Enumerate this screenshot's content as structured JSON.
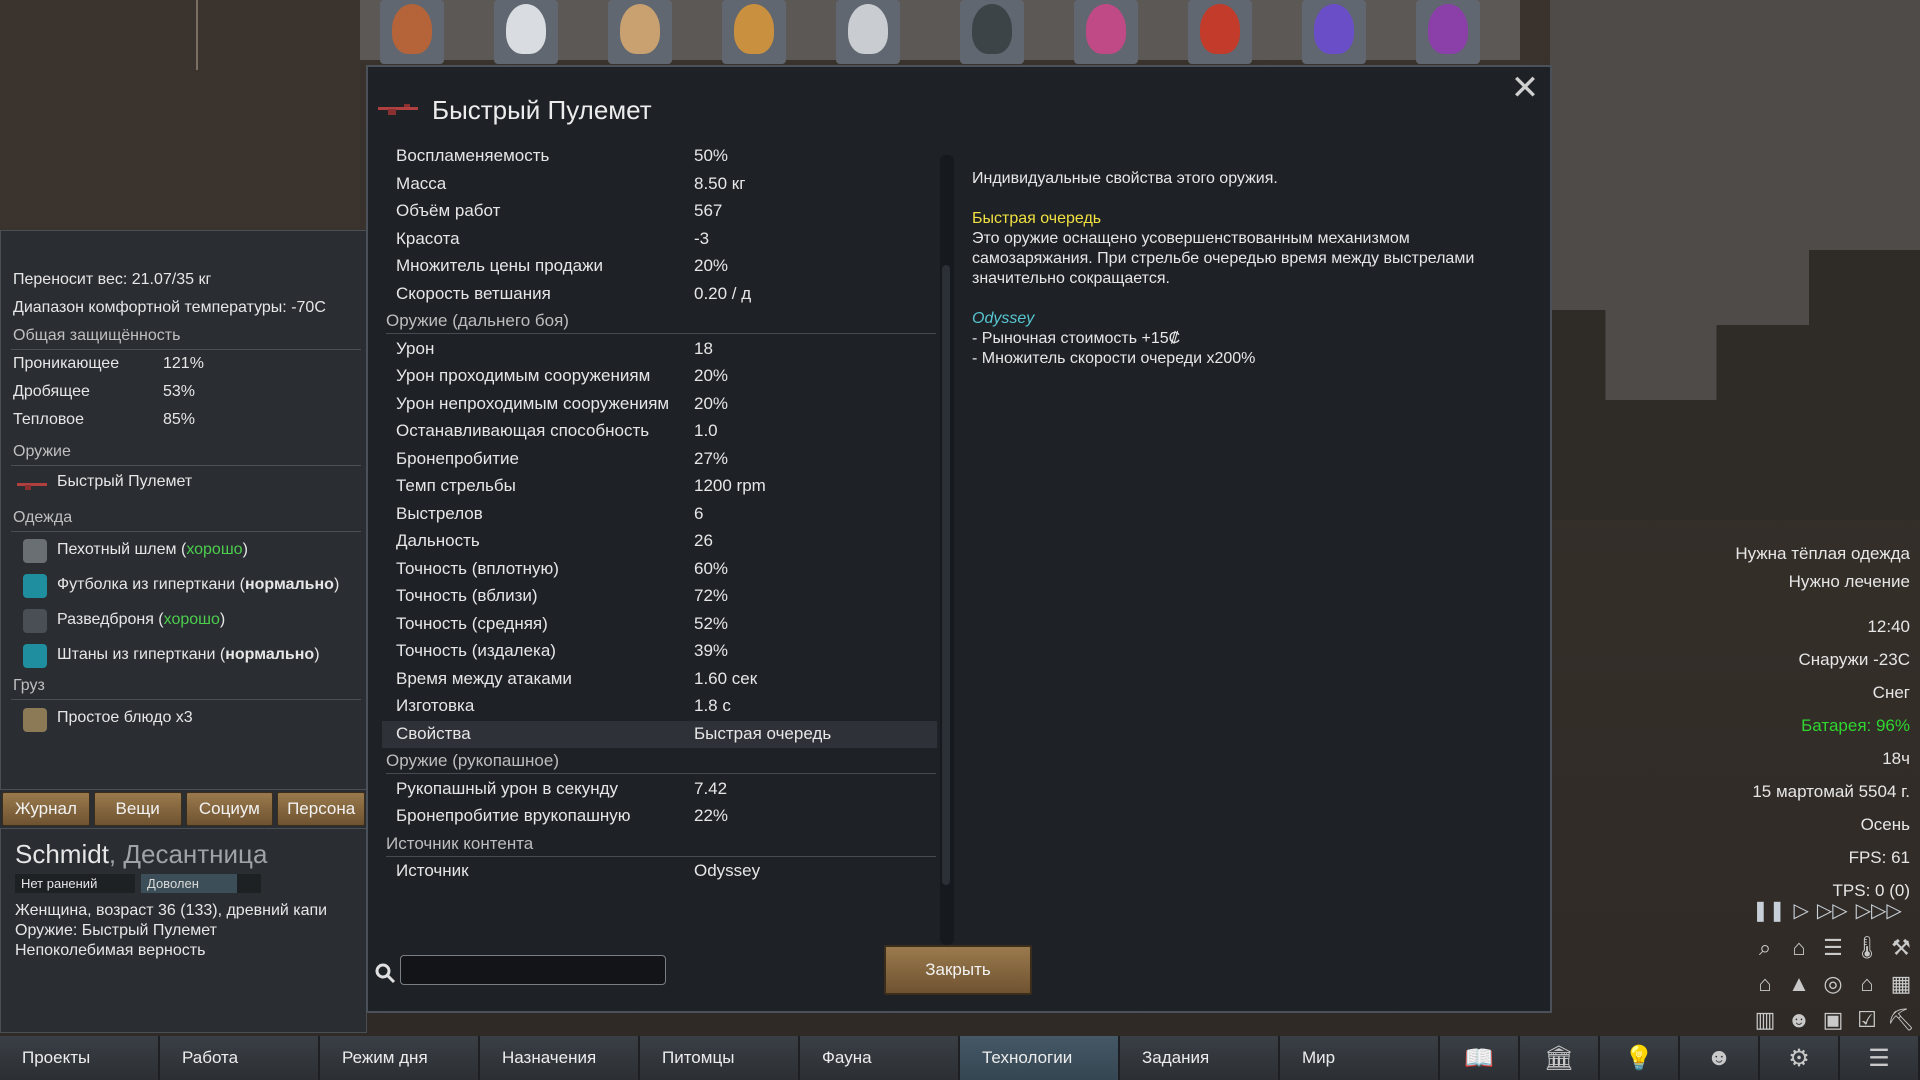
{
  "colonists": [
    {
      "name": "colonist-1",
      "color": "#b5643a"
    },
    {
      "name": "colonist-2",
      "color": "#d9dde2"
    },
    {
      "name": "colonist-3",
      "color": "#c9a070"
    },
    {
      "name": "colonist-4",
      "color": "#c99040"
    },
    {
      "name": "colonist-5",
      "color": "#c9ccd0"
    },
    {
      "name": "colonist-6",
      "color": "#3d4448"
    },
    {
      "name": "colonist-7",
      "color": "#c04a86"
    },
    {
      "name": "colonist-8",
      "color": "#c23b2b"
    },
    {
      "name": "colonist-9",
      "color": "#6a4ec7"
    },
    {
      "name": "colonist-10",
      "color": "#8b3fa8"
    }
  ],
  "inspect": {
    "carry_weight": "Переносит вес: 21.07/35 кг",
    "comfort_temp": "Диапазон комфортной температуры: -70C",
    "armor_section": "Общая защищённость",
    "armor": [
      {
        "label": "Проникающее",
        "value": "121%"
      },
      {
        "label": "Дробящее",
        "value": "53%"
      },
      {
        "label": "Тепловое",
        "value": "85%"
      }
    ],
    "weapon_section": "Оружие",
    "weapon": "Быстрый Пулемет",
    "apparel_section": "Одежда",
    "apparel": [
      {
        "name": "Пехотный шлем (",
        "quality": "хорошо",
        "suffix": ")",
        "quality_class": "good",
        "icon_color": "#6a6f74"
      },
      {
        "name": "Футболка из гиперткани (",
        "quality": "нормально",
        "suffix": ")",
        "quality_class": "bold",
        "icon_color": "#1f8fa0"
      },
      {
        "name": "Разведброня (",
        "quality": "хорошо",
        "suffix": ")",
        "quality_class": "good",
        "icon_color": "#4a4f55"
      },
      {
        "name": "Штаны из гиперткани (",
        "quality": "нормально",
        "suffix": ")",
        "quality_class": "bold",
        "icon_color": "#1f8fa0"
      }
    ],
    "cargo_section": "Груз",
    "cargo": "Простое блюдо x3"
  },
  "left_tabs": [
    "Журнал",
    "Вещи",
    "Социум",
    "Персона"
  ],
  "pawn": {
    "name": "Schmidt",
    "title": ", Десантница",
    "health_badge": "Нет ранений",
    "mood_badge": "Доволен",
    "lines": [
      "Женщина, возраст 36 (133), древний капи",
      "Оружие: Быстрый Пулемет",
      "Непоколебимая верность"
    ]
  },
  "dialog": {
    "title": "Быстрый Пулемет",
    "close_label": "Закрыть",
    "search_placeholder": "",
    "categories": {
      "ranged": "Оружие (дальнего боя)",
      "melee": "Оружие (рукопашное)",
      "source": "Источник контента"
    },
    "stats_top": [
      {
        "label": "Воспламеняемость",
        "value": "50%"
      },
      {
        "label": "Масса",
        "value": "8.50 кг"
      },
      {
        "label": "Объём работ",
        "value": "567"
      },
      {
        "label": "Красота",
        "value": "-3"
      },
      {
        "label": "Множитель цены продажи",
        "value": "20%"
      },
      {
        "label": "Скорость ветшания",
        "value": "0.20 / д"
      }
    ],
    "stats_ranged": [
      {
        "label": "Урон",
        "value": "18"
      },
      {
        "label": "Урон проходимым сооружениям",
        "value": "20%"
      },
      {
        "label": "Урон непроходимым сооружениям",
        "value": "20%"
      },
      {
        "label": "Останавливающая способность",
        "value": "1.0"
      },
      {
        "label": "Бронепробитие",
        "value": "27%"
      },
      {
        "label": "Темп стрельбы",
        "value": "1200 rpm"
      },
      {
        "label": "Выстрелов",
        "value": "6"
      },
      {
        "label": "Дальность",
        "value": "26"
      },
      {
        "label": "Точность (вплотную)",
        "value": "60%"
      },
      {
        "label": "Точность (вблизи)",
        "value": "72%"
      },
      {
        "label": "Точность (средняя)",
        "value": "52%"
      },
      {
        "label": "Точность (издалека)",
        "value": "39%"
      },
      {
        "label": "Время между атаками",
        "value": "1.60 сек"
      },
      {
        "label": "Изготовка",
        "value": "1.8 с"
      },
      {
        "label": "Свойства",
        "value": "Быстрая очередь"
      }
    ],
    "stats_melee": [
      {
        "label": "Рукопашный урон в секунду",
        "value": "7.42"
      },
      {
        "label": "Бронепробитие врукопашную",
        "value": "22%"
      }
    ],
    "stats_source": [
      {
        "label": "Источник",
        "value": "Odyssey"
      }
    ],
    "description": {
      "intro": "Индивидуальные свойства этого оружия.",
      "trait_title": "Быстрая очередь",
      "trait_text": "Это оружие оснащено усовершенствованным механизмом самозаряжания. При стрельбе очередью время между выстрелами значительно сокращается.",
      "source_title": "Odyssey",
      "source_lines": [
        " - Рыночная стоимость +15₡",
        " - Множитель скорости очереди x200%"
      ]
    }
  },
  "readouts": {
    "alert1": "Нужна тёплая одежда",
    "alert2": "Нужно лечение",
    "time": "12:40",
    "outside_temp": "Снаружи -23C",
    "weather": "Снег",
    "battery": "Батарея: 96%",
    "hour": "18ч",
    "date": "15 мартомай 5504 г.",
    "season": "Осень",
    "fps": "FPS: 61",
    "tps": "TPS: 0 (0)"
  },
  "bottom_tabs": [
    "Проекты",
    "Работа",
    "Режим дня",
    "Назначения",
    "Питомцы",
    "Фауна",
    "Технологии",
    "Задания",
    "Мир"
  ],
  "active_tab": "Технологии"
}
